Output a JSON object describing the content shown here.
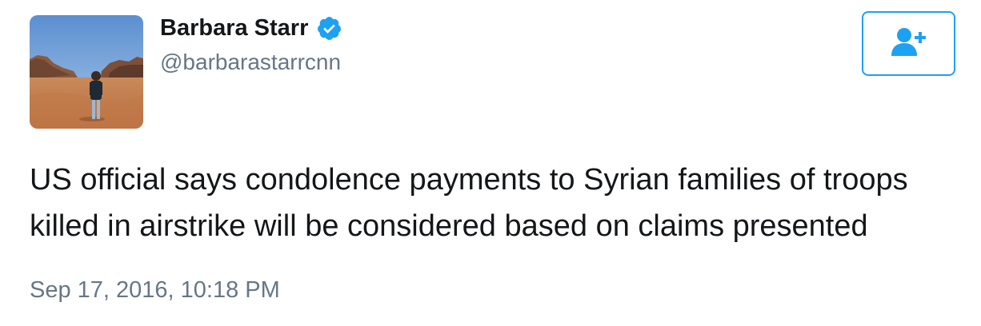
{
  "user": {
    "display_name": "Barbara Starr",
    "handle": "@barbarastarrcnn",
    "verified": true,
    "verified_icon": "verified-badge-icon",
    "avatar": "profile-photo-desert"
  },
  "follow_button": {
    "icon": "add-user-icon"
  },
  "tweet": {
    "text": "US official says condolence payments to Syrian families of troops killed in airstrike will be considered based on claims presented",
    "timestamp": "Sep 17, 2016, 10:18 PM"
  },
  "colors": {
    "accent": "#1da1f2",
    "text_primary": "#14171a",
    "text_secondary": "#657786"
  }
}
